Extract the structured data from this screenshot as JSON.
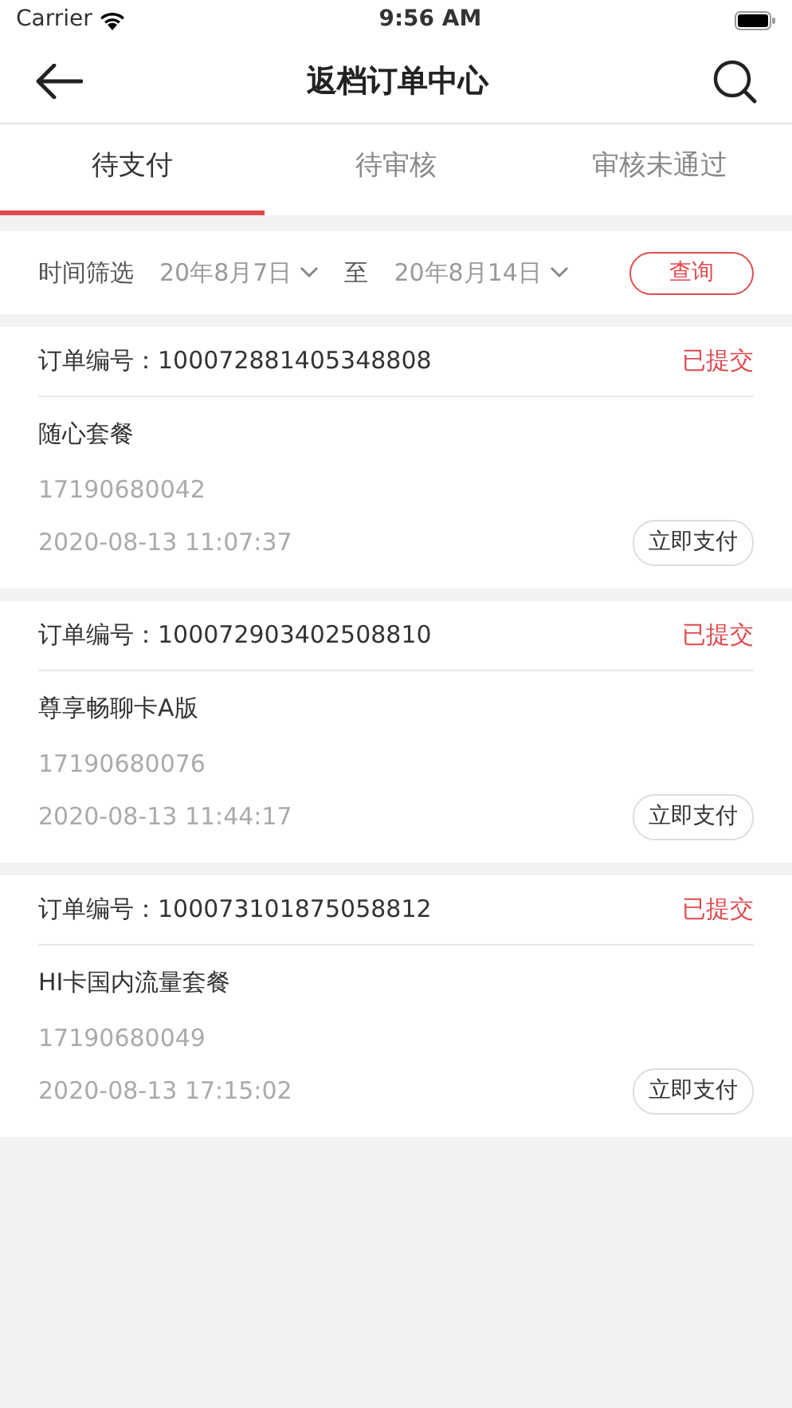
{
  "status_bar": {
    "carrier": "Carrier",
    "time": "9:56 AM"
  },
  "nav": {
    "title": "返档订单中心"
  },
  "tabs": [
    {
      "label": "待支付",
      "selected": true
    },
    {
      "label": "待审核",
      "selected": false
    },
    {
      "label": "审核未通过",
      "selected": false
    }
  ],
  "filter": {
    "label": "时间筛选",
    "start": "20年8月7日",
    "separator": "至",
    "end": "20年8月14日",
    "button": "查询"
  },
  "orders": [
    {
      "number_label": "订单编号：100072881405348808",
      "status": "已提交",
      "package": "随心套餐",
      "phone": "17190680042",
      "time": "2020-08-13 11:07:37",
      "action": "立即支付"
    },
    {
      "number_label": "订单编号：100072903402508810",
      "status": "已提交",
      "package": "尊享畅聊卡A版",
      "phone": "17190680076",
      "time": "2020-08-13 11:44:17",
      "action": "立即支付"
    },
    {
      "number_label": "订单编号：100073101875058812",
      "status": "已提交",
      "package": "HI卡国内流量套餐",
      "phone": "17190680049",
      "time": "2020-08-13 17:15:02",
      "action": "立即支付"
    }
  ]
}
